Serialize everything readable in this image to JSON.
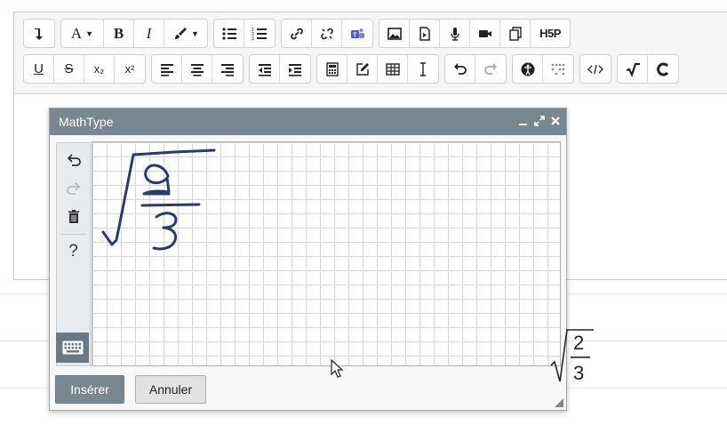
{
  "toolbar": {
    "row1": [
      {
        "group": "g1",
        "items": [
          {
            "name": "toggle-toolbar-button",
            "icon": "arrow-down-left-icon"
          }
        ]
      },
      {
        "group": "g2",
        "items": [
          {
            "name": "font-color-button",
            "icon": "font-color-icon",
            "label": "A"
          },
          {
            "name": "bold-button",
            "label": "B"
          },
          {
            "name": "italic-button",
            "label": "I"
          },
          {
            "name": "highlight-button",
            "icon": "brush-icon"
          }
        ]
      },
      {
        "group": "g3",
        "items": [
          {
            "name": "bullet-list-button",
            "icon": "bullet-list-icon"
          },
          {
            "name": "numbered-list-button",
            "icon": "numbered-list-icon"
          }
        ]
      },
      {
        "group": "g4",
        "items": [
          {
            "name": "link-button",
            "icon": "link-icon"
          },
          {
            "name": "unlink-button",
            "icon": "unlink-icon"
          },
          {
            "name": "teams-button",
            "icon": "teams-icon"
          }
        ]
      },
      {
        "group": "g5",
        "items": [
          {
            "name": "image-button",
            "icon": "image-icon"
          },
          {
            "name": "media-button",
            "icon": "file-media-icon"
          },
          {
            "name": "record-audio-button",
            "icon": "microphone-icon"
          },
          {
            "name": "record-video-button",
            "icon": "video-camera-icon"
          },
          {
            "name": "manage-files-button",
            "icon": "files-icon"
          },
          {
            "name": "h5p-button",
            "label": "H5P"
          }
        ]
      }
    ],
    "row2": [
      {
        "group": "g6",
        "items": [
          {
            "name": "underline-button",
            "label": "U"
          },
          {
            "name": "strikethrough-button",
            "label": "S"
          },
          {
            "name": "subscript-button",
            "label": "x₂"
          },
          {
            "name": "superscript-button",
            "label": "x²"
          }
        ]
      },
      {
        "group": "g7",
        "items": [
          {
            "name": "align-left-button",
            "icon": "align-left-icon"
          },
          {
            "name": "align-center-button",
            "icon": "align-center-icon"
          },
          {
            "name": "align-right-button",
            "icon": "align-right-icon"
          }
        ]
      },
      {
        "group": "g8",
        "items": [
          {
            "name": "outdent-button",
            "icon": "outdent-icon"
          },
          {
            "name": "indent-button",
            "icon": "indent-icon"
          }
        ]
      },
      {
        "group": "g9",
        "items": [
          {
            "name": "equation-button",
            "icon": "calculator-icon"
          },
          {
            "name": "edit-button",
            "icon": "pencil-square-icon"
          },
          {
            "name": "table-button",
            "icon": "table-icon"
          },
          {
            "name": "clear-formatting-button",
            "icon": "text-cursor-icon"
          }
        ]
      },
      {
        "group": "g10",
        "items": [
          {
            "name": "undo-button",
            "icon": "undo-icon"
          },
          {
            "name": "redo-button",
            "icon": "redo-icon"
          }
        ]
      },
      {
        "group": "g11",
        "items": [
          {
            "name": "accessibility-button",
            "icon": "accessibility-icon"
          },
          {
            "name": "screenreader-button",
            "icon": "braille-icon"
          }
        ]
      },
      {
        "group": "g12",
        "items": [
          {
            "name": "html-button",
            "icon": "code-icon"
          }
        ]
      },
      {
        "group": "g13",
        "items": [
          {
            "name": "mathtype-button",
            "icon": "sqrt-icon"
          },
          {
            "name": "chemtype-button",
            "icon": "chem-c-icon"
          }
        ]
      }
    ]
  },
  "dialog": {
    "title": "MathType",
    "controls": [
      "minimize-icon",
      "fullscreen-icon",
      "close-icon"
    ],
    "side_tools": [
      "undo-icon",
      "redo-icon",
      "trash-icon",
      "help-icon"
    ],
    "help_label": "?",
    "keyboard_icon": "keyboard-icon",
    "preview": {
      "numerator": "2",
      "denominator": "3"
    },
    "insert_label": "Insérer",
    "cancel_label": "Annuler"
  },
  "colors": {
    "titlebar": "#778893",
    "ink": "#2b3a6b",
    "insert": "#778893"
  }
}
